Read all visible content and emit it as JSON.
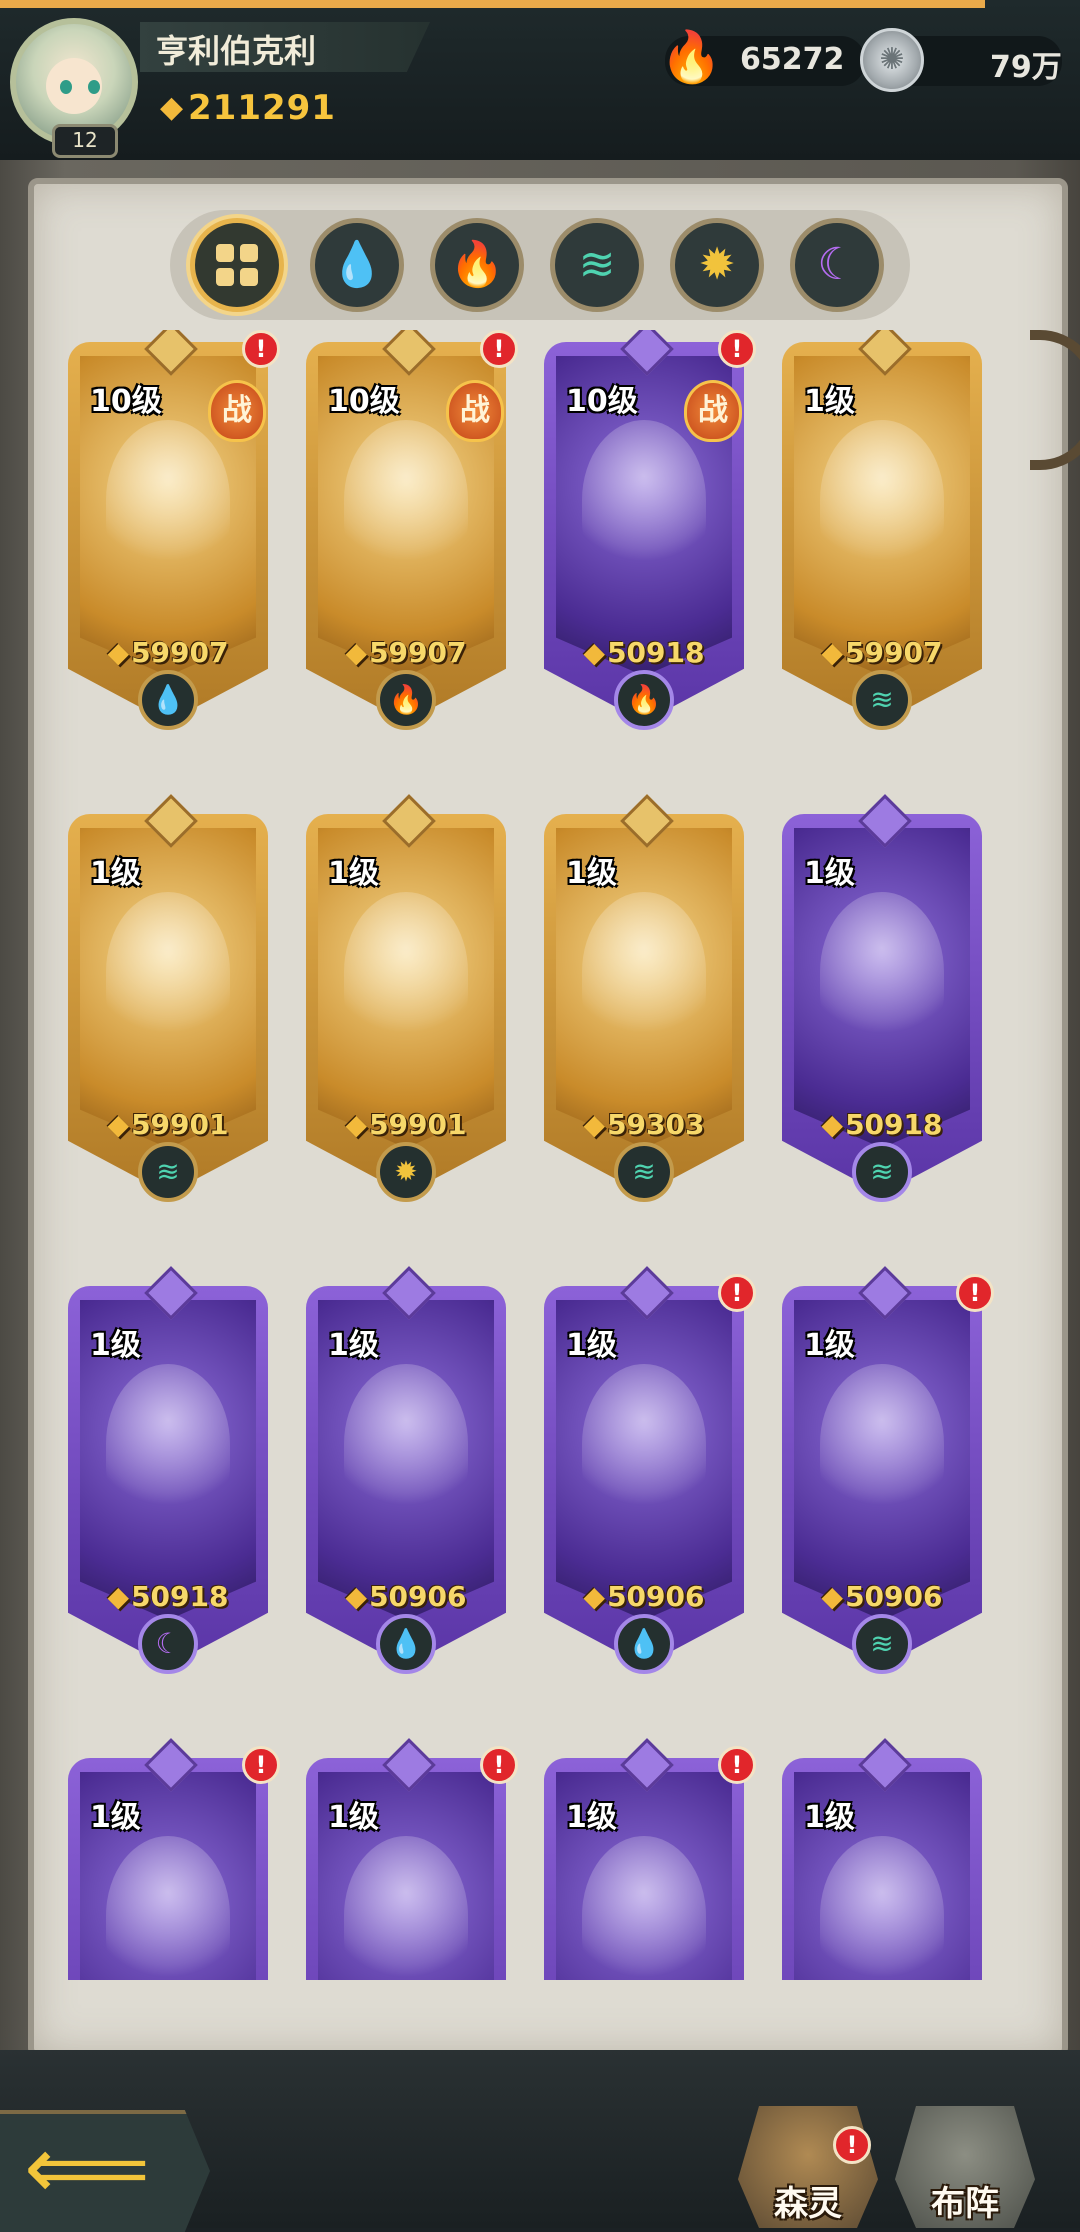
{
  "player": {
    "name": "亨利伯克利",
    "level": "12",
    "power": "211291"
  },
  "resources": {
    "flame_value": "65272",
    "coin_value": "79万"
  },
  "filter_tabs": [
    {
      "name": "all",
      "icon": "grid-icon",
      "active": true
    },
    {
      "name": "water",
      "icon": "water-drop-icon",
      "active": false
    },
    {
      "name": "fire",
      "icon": "fire-icon",
      "active": false
    },
    {
      "name": "wind",
      "icon": "wind-icon",
      "active": false
    },
    {
      "name": "light",
      "icon": "sun-icon",
      "active": false
    },
    {
      "name": "dark",
      "icon": "moon-icon",
      "active": false
    }
  ],
  "cards": [
    {
      "level": "10级",
      "power": "59907",
      "element": "water",
      "rarity": "gold",
      "battle": "战",
      "alert": "!"
    },
    {
      "level": "10级",
      "power": "59907",
      "element": "fire",
      "rarity": "gold",
      "battle": "战",
      "alert": "!"
    },
    {
      "level": "10级",
      "power": "50918",
      "element": "fire",
      "rarity": "purple",
      "battle": "战",
      "alert": "!"
    },
    {
      "level": "1级",
      "power": "59907",
      "element": "wind",
      "rarity": "gold",
      "battle": "",
      "alert": ""
    },
    {
      "level": "1级",
      "power": "59901",
      "element": "wind",
      "rarity": "gold",
      "battle": "",
      "alert": ""
    },
    {
      "level": "1级",
      "power": "59901",
      "element": "light",
      "rarity": "gold",
      "battle": "",
      "alert": ""
    },
    {
      "level": "1级",
      "power": "59303",
      "element": "wind",
      "rarity": "gold",
      "battle": "",
      "alert": ""
    },
    {
      "level": "1级",
      "power": "50918",
      "element": "wind",
      "rarity": "purple",
      "battle": "",
      "alert": ""
    },
    {
      "level": "1级",
      "power": "50918",
      "element": "dark",
      "rarity": "purple",
      "battle": "",
      "alert": ""
    },
    {
      "level": "1级",
      "power": "50906",
      "element": "water",
      "rarity": "purple",
      "battle": "",
      "alert": ""
    },
    {
      "level": "1级",
      "power": "50906",
      "element": "water",
      "rarity": "purple",
      "battle": "",
      "alert": "!"
    },
    {
      "level": "1级",
      "power": "50906",
      "element": "wind",
      "rarity": "purple",
      "battle": "",
      "alert": "!"
    },
    {
      "level": "1级",
      "power": "",
      "element": "",
      "rarity": "purple",
      "battle": "",
      "alert": "!"
    },
    {
      "level": "1级",
      "power": "",
      "element": "",
      "rarity": "purple",
      "battle": "",
      "alert": "!"
    },
    {
      "level": "1级",
      "power": "",
      "element": "",
      "rarity": "purple",
      "battle": "",
      "alert": "!"
    },
    {
      "level": "1级",
      "power": "",
      "element": "",
      "rarity": "purple",
      "battle": "",
      "alert": ""
    }
  ],
  "bottom_nav": {
    "spirits_label": "森灵",
    "formation_label": "布阵",
    "spirits_alert": "!"
  },
  "icons": {
    "back": "back-arrow-icon",
    "flame": "blue-flame-icon",
    "coin": "silver-coin-icon",
    "power": "power-gem-icon"
  }
}
